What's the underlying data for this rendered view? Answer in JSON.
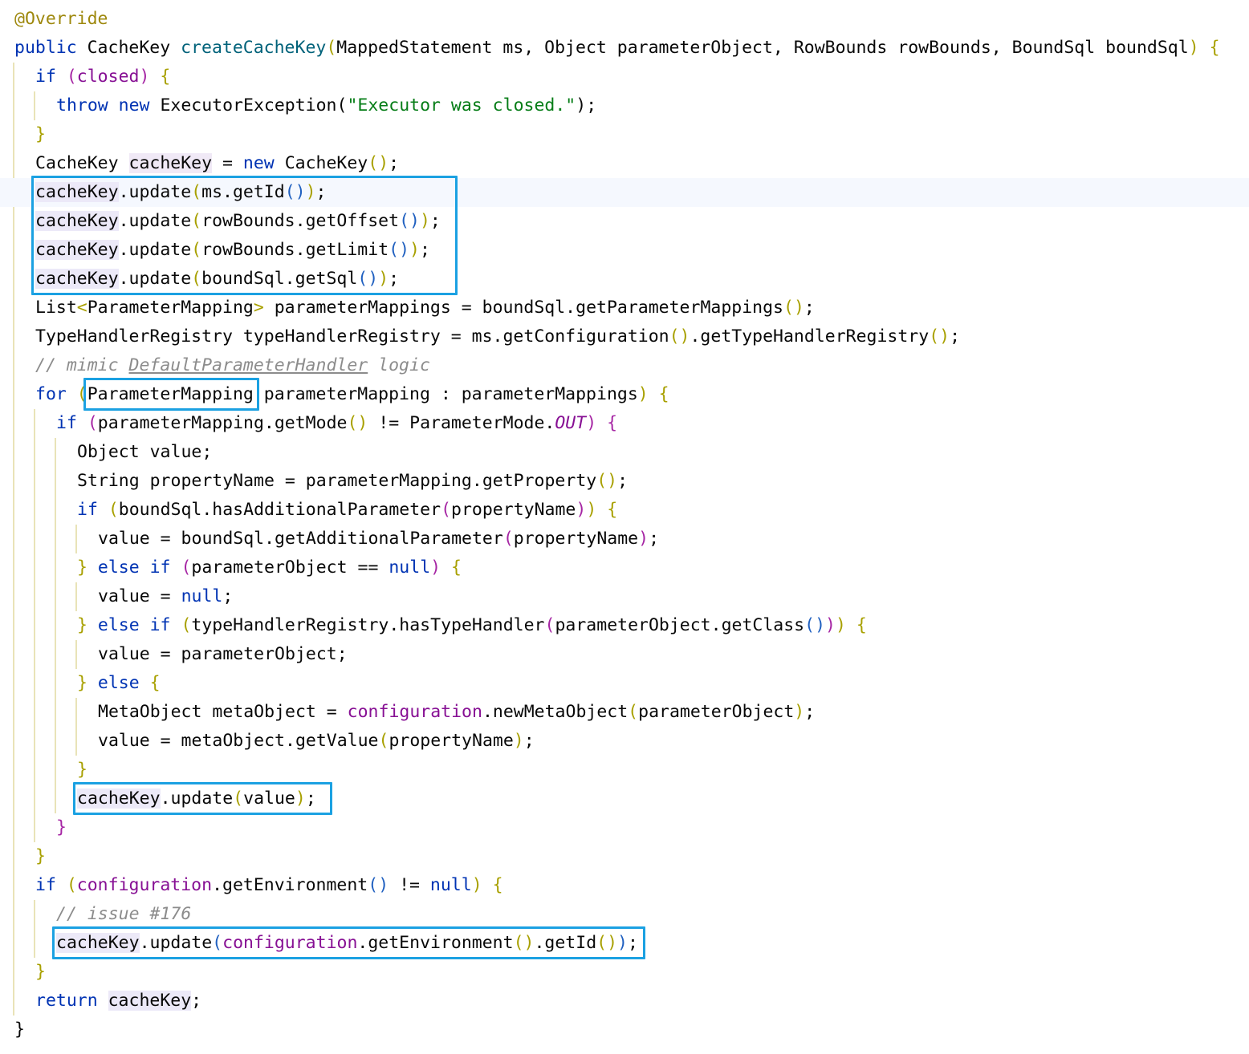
{
  "editor": {
    "lines": [
      {
        "indent": 0,
        "tokens": [
          {
            "t": "@Override",
            "c": "ann"
          }
        ]
      },
      {
        "indent": 0,
        "tokens": [
          {
            "t": "public ",
            "c": "kw"
          },
          {
            "t": "CacheKey ",
            "c": "plain"
          },
          {
            "t": "createCacheKey",
            "c": "fn"
          },
          {
            "t": "(",
            "c": "p1"
          },
          {
            "t": "MappedStatement ms, Object parameterObject, RowBounds rowBounds, BoundSql boundSql",
            "c": "plain"
          },
          {
            "t": ")",
            "c": "p1"
          },
          {
            "t": " {",
            "c": "p1"
          }
        ]
      },
      {
        "indent": 1,
        "tokens": [
          {
            "t": "if ",
            "c": "kw"
          },
          {
            "t": "(",
            "c": "p2"
          },
          {
            "t": "closed",
            "c": "field"
          },
          {
            "t": ")",
            "c": "p2"
          },
          {
            "t": " {",
            "c": "p1"
          }
        ]
      },
      {
        "indent": 2,
        "tokens": [
          {
            "t": "throw ",
            "c": "kw"
          },
          {
            "t": "new ",
            "c": "kw"
          },
          {
            "t": "ExecutorException",
            "c": "plain"
          },
          {
            "t": "(",
            "c": "plain"
          },
          {
            "t": "\"Executor was closed.\"",
            "c": "str"
          },
          {
            "t": ");",
            "c": "plain"
          }
        ]
      },
      {
        "indent": 1,
        "tokens": [
          {
            "t": "}",
            "c": "p1"
          }
        ]
      },
      {
        "indent": 1,
        "tokens": [
          {
            "t": "CacheKey ",
            "c": "plain"
          },
          {
            "t": "cacheKey",
            "c": "var"
          },
          {
            "t": " = ",
            "c": "plain"
          },
          {
            "t": "new ",
            "c": "kw"
          },
          {
            "t": "CacheKey",
            "c": "plain"
          },
          {
            "t": "()",
            "c": "p1"
          },
          {
            "t": ";",
            "c": "plain"
          }
        ]
      },
      {
        "indent": 1,
        "current": true,
        "tokens": [
          {
            "t": "cacheKey",
            "c": "var2"
          },
          {
            "t": ".update",
            "c": "plain"
          },
          {
            "t": "(",
            "c": "p1"
          },
          {
            "t": "ms.getId",
            "c": "plain"
          },
          {
            "t": "()",
            "c": "p3"
          },
          {
            "t": ")",
            "c": "p1"
          },
          {
            "t": ";",
            "c": "plain"
          }
        ]
      },
      {
        "indent": 1,
        "tokens": [
          {
            "t": "cacheKey",
            "c": "var2"
          },
          {
            "t": ".update",
            "c": "plain"
          },
          {
            "t": "(",
            "c": "p1"
          },
          {
            "t": "rowBounds.getOffset",
            "c": "plain"
          },
          {
            "t": "()",
            "c": "p3"
          },
          {
            "t": ")",
            "c": "p1"
          },
          {
            "t": ";",
            "c": "plain"
          }
        ]
      },
      {
        "indent": 1,
        "tokens": [
          {
            "t": "cacheKey",
            "c": "var2"
          },
          {
            "t": ".update",
            "c": "plain"
          },
          {
            "t": "(",
            "c": "p1"
          },
          {
            "t": "rowBounds.getLimit",
            "c": "plain"
          },
          {
            "t": "()",
            "c": "p3"
          },
          {
            "t": ")",
            "c": "p1"
          },
          {
            "t": ";",
            "c": "plain"
          }
        ]
      },
      {
        "indent": 1,
        "tokens": [
          {
            "t": "cacheKey",
            "c": "var2"
          },
          {
            "t": ".update",
            "c": "plain"
          },
          {
            "t": "(",
            "c": "p1"
          },
          {
            "t": "boundSql.getSql",
            "c": "plain"
          },
          {
            "t": "()",
            "c": "p3"
          },
          {
            "t": ")",
            "c": "p1"
          },
          {
            "t": ";",
            "c": "plain"
          }
        ]
      },
      {
        "indent": 1,
        "tokens": [
          {
            "t": "List",
            "c": "plain"
          },
          {
            "t": "<",
            "c": "p1"
          },
          {
            "t": "ParameterMapping",
            "c": "plain"
          },
          {
            "t": ">",
            "c": "p1"
          },
          {
            "t": " parameterMappings = boundSql.getParameterMappings",
            "c": "plain"
          },
          {
            "t": "()",
            "c": "p1"
          },
          {
            "t": ";",
            "c": "plain"
          }
        ]
      },
      {
        "indent": 1,
        "tokens": [
          {
            "t": "TypeHandlerRegistry typeHandlerRegistry = ms.getConfiguration",
            "c": "plain"
          },
          {
            "t": "()",
            "c": "p1"
          },
          {
            "t": ".getTypeHandlerRegistry",
            "c": "plain"
          },
          {
            "t": "()",
            "c": "p1"
          },
          {
            "t": ";",
            "c": "plain"
          }
        ]
      },
      {
        "indent": 1,
        "tokens": [
          {
            "t": "// mimic ",
            "c": "cmt"
          },
          {
            "t": "DefaultParameterHandler",
            "c": "ul"
          },
          {
            "t": " logic",
            "c": "cmt"
          }
        ]
      },
      {
        "indent": 1,
        "tokens": [
          {
            "t": "for ",
            "c": "kw"
          },
          {
            "t": "(",
            "c": "p1"
          },
          {
            "t": "ParameterMapping parameterMapping : parameterMappings",
            "c": "plain"
          },
          {
            "t": ")",
            "c": "p1"
          },
          {
            "t": " {",
            "c": "p1"
          }
        ]
      },
      {
        "indent": 2,
        "tokens": [
          {
            "t": "if ",
            "c": "kw"
          },
          {
            "t": "(",
            "c": "p2"
          },
          {
            "t": "parameterMapping.getMode",
            "c": "plain"
          },
          {
            "t": "()",
            "c": "p1"
          },
          {
            "t": " != ParameterMode.",
            "c": "plain"
          },
          {
            "t": "OUT",
            "c": "const"
          },
          {
            "t": ")",
            "c": "p2"
          },
          {
            "t": " {",
            "c": "p2"
          }
        ]
      },
      {
        "indent": 3,
        "tokens": [
          {
            "t": "Object value;",
            "c": "plain"
          }
        ]
      },
      {
        "indent": 3,
        "tokens": [
          {
            "t": "String propertyName = parameterMapping.getProperty",
            "c": "plain"
          },
          {
            "t": "()",
            "c": "p1"
          },
          {
            "t": ";",
            "c": "plain"
          }
        ]
      },
      {
        "indent": 3,
        "tokens": [
          {
            "t": "if ",
            "c": "kw"
          },
          {
            "t": "(",
            "c": "p1"
          },
          {
            "t": "boundSql.hasAdditionalParameter",
            "c": "plain"
          },
          {
            "t": "(",
            "c": "p2"
          },
          {
            "t": "propertyName",
            "c": "plain"
          },
          {
            "t": ")",
            "c": "p2"
          },
          {
            "t": ")",
            "c": "p1"
          },
          {
            "t": " {",
            "c": "p1"
          }
        ]
      },
      {
        "indent": 4,
        "tokens": [
          {
            "t": "value = boundSql.getAdditionalParameter",
            "c": "plain"
          },
          {
            "t": "(",
            "c": "p2"
          },
          {
            "t": "propertyName",
            "c": "plain"
          },
          {
            "t": ")",
            "c": "p2"
          },
          {
            "t": ";",
            "c": "plain"
          }
        ]
      },
      {
        "indent": 3,
        "tokens": [
          {
            "t": "} ",
            "c": "p1"
          },
          {
            "t": "else if ",
            "c": "kw"
          },
          {
            "t": "(",
            "c": "p2"
          },
          {
            "t": "parameterObject == ",
            "c": "plain"
          },
          {
            "t": "null",
            "c": "kw"
          },
          {
            "t": ")",
            "c": "p2"
          },
          {
            "t": " {",
            "c": "p1"
          }
        ]
      },
      {
        "indent": 4,
        "tokens": [
          {
            "t": "value = ",
            "c": "plain"
          },
          {
            "t": "null",
            "c": "kw"
          },
          {
            "t": ";",
            "c": "plain"
          }
        ]
      },
      {
        "indent": 3,
        "tokens": [
          {
            "t": "} ",
            "c": "p1"
          },
          {
            "t": "else if ",
            "c": "kw"
          },
          {
            "t": "(",
            "c": "p1"
          },
          {
            "t": "typeHandlerRegistry.hasTypeHandler",
            "c": "plain"
          },
          {
            "t": "(",
            "c": "p2"
          },
          {
            "t": "parameterObject.getClass",
            "c": "plain"
          },
          {
            "t": "()",
            "c": "p3"
          },
          {
            "t": ")",
            "c": "p2"
          },
          {
            "t": ")",
            "c": "p1"
          },
          {
            "t": " {",
            "c": "p1"
          }
        ]
      },
      {
        "indent": 4,
        "tokens": [
          {
            "t": "value = parameterObject;",
            "c": "plain"
          }
        ]
      },
      {
        "indent": 3,
        "tokens": [
          {
            "t": "} ",
            "c": "p1"
          },
          {
            "t": "else ",
            "c": "kw"
          },
          {
            "t": "{",
            "c": "p1"
          }
        ]
      },
      {
        "indent": 4,
        "tokens": [
          {
            "t": "MetaObject metaObject = ",
            "c": "plain"
          },
          {
            "t": "configuration",
            "c": "field"
          },
          {
            "t": ".newMetaObject",
            "c": "plain"
          },
          {
            "t": "(",
            "c": "p1"
          },
          {
            "t": "parameterObject",
            "c": "plain"
          },
          {
            "t": ")",
            "c": "p1"
          },
          {
            "t": ";",
            "c": "plain"
          }
        ]
      },
      {
        "indent": 4,
        "tokens": [
          {
            "t": "value = metaObject.getValue",
            "c": "plain"
          },
          {
            "t": "(",
            "c": "p1"
          },
          {
            "t": "propertyName",
            "c": "plain"
          },
          {
            "t": ")",
            "c": "p1"
          },
          {
            "t": ";",
            "c": "plain"
          }
        ]
      },
      {
        "indent": 3,
        "tokens": [
          {
            "t": "}",
            "c": "p1"
          }
        ]
      },
      {
        "indent": 3,
        "tokens": [
          {
            "t": "cacheKey",
            "c": "var2"
          },
          {
            "t": ".update",
            "c": "plain"
          },
          {
            "t": "(",
            "c": "p1"
          },
          {
            "t": "value",
            "c": "plain"
          },
          {
            "t": ")",
            "c": "p1"
          },
          {
            "t": ";",
            "c": "plain"
          }
        ]
      },
      {
        "indent": 2,
        "tokens": [
          {
            "t": "}",
            "c": "p2"
          }
        ]
      },
      {
        "indent": 1,
        "tokens": [
          {
            "t": "}",
            "c": "p1"
          }
        ]
      },
      {
        "indent": 1,
        "tokens": [
          {
            "t": "if ",
            "c": "kw"
          },
          {
            "t": "(",
            "c": "p1"
          },
          {
            "t": "configuration",
            "c": "field"
          },
          {
            "t": ".getEnvironment",
            "c": "plain"
          },
          {
            "t": "()",
            "c": "p3"
          },
          {
            "t": " != ",
            "c": "plain"
          },
          {
            "t": "null",
            "c": "kw"
          },
          {
            "t": ")",
            "c": "p1"
          },
          {
            "t": " {",
            "c": "p1"
          }
        ]
      },
      {
        "indent": 2,
        "tokens": [
          {
            "t": "// issue #176",
            "c": "cmt"
          }
        ]
      },
      {
        "indent": 2,
        "tokens": [
          {
            "t": "cacheKey",
            "c": "var2"
          },
          {
            "t": ".update",
            "c": "plain"
          },
          {
            "t": "(",
            "c": "p3"
          },
          {
            "t": "configuration",
            "c": "field"
          },
          {
            "t": ".getEnvironment",
            "c": "plain"
          },
          {
            "t": "()",
            "c": "p1"
          },
          {
            "t": ".getId",
            "c": "plain"
          },
          {
            "t": "()",
            "c": "p1"
          },
          {
            "t": ")",
            "c": "p3"
          },
          {
            "t": ";",
            "c": "plain"
          }
        ]
      },
      {
        "indent": 1,
        "tokens": [
          {
            "t": "}",
            "c": "p1"
          }
        ]
      },
      {
        "indent": 1,
        "tokens": [
          {
            "t": "return ",
            "c": "kw"
          },
          {
            "t": "cacheKey",
            "c": "var2"
          },
          {
            "t": ";",
            "c": "plain"
          }
        ]
      },
      {
        "indent": 0,
        "tokens": [
          {
            "t": "}",
            "c": "plain"
          }
        ]
      }
    ]
  },
  "annotations": {
    "highlight_color": "#1ba1e2",
    "boxes": [
      {
        "line_start": 6,
        "line_end": 9,
        "col_start": 0,
        "col_end": 40,
        "label": "cacheKey update block"
      },
      {
        "line_start": 13,
        "line_end": 13,
        "col_start": 5,
        "col_end": 21,
        "label": "ParameterMapping type"
      },
      {
        "line_start": 27,
        "line_end": 27,
        "col_start": 0,
        "col_end": 24,
        "label": "cacheKey update value"
      },
      {
        "line_start": 32,
        "line_end": 32,
        "col_start": 0,
        "col_end": 56,
        "label": "cacheKey update environment id"
      }
    ]
  },
  "colors": {
    "background": "#ffffff",
    "keyword": "#0033b3",
    "annotation": "#9e880d",
    "method_decl": "#00627a",
    "string": "#067d17",
    "comment": "#8c8c8c",
    "field": "#871094",
    "current_line": "#f5f8fe"
  }
}
